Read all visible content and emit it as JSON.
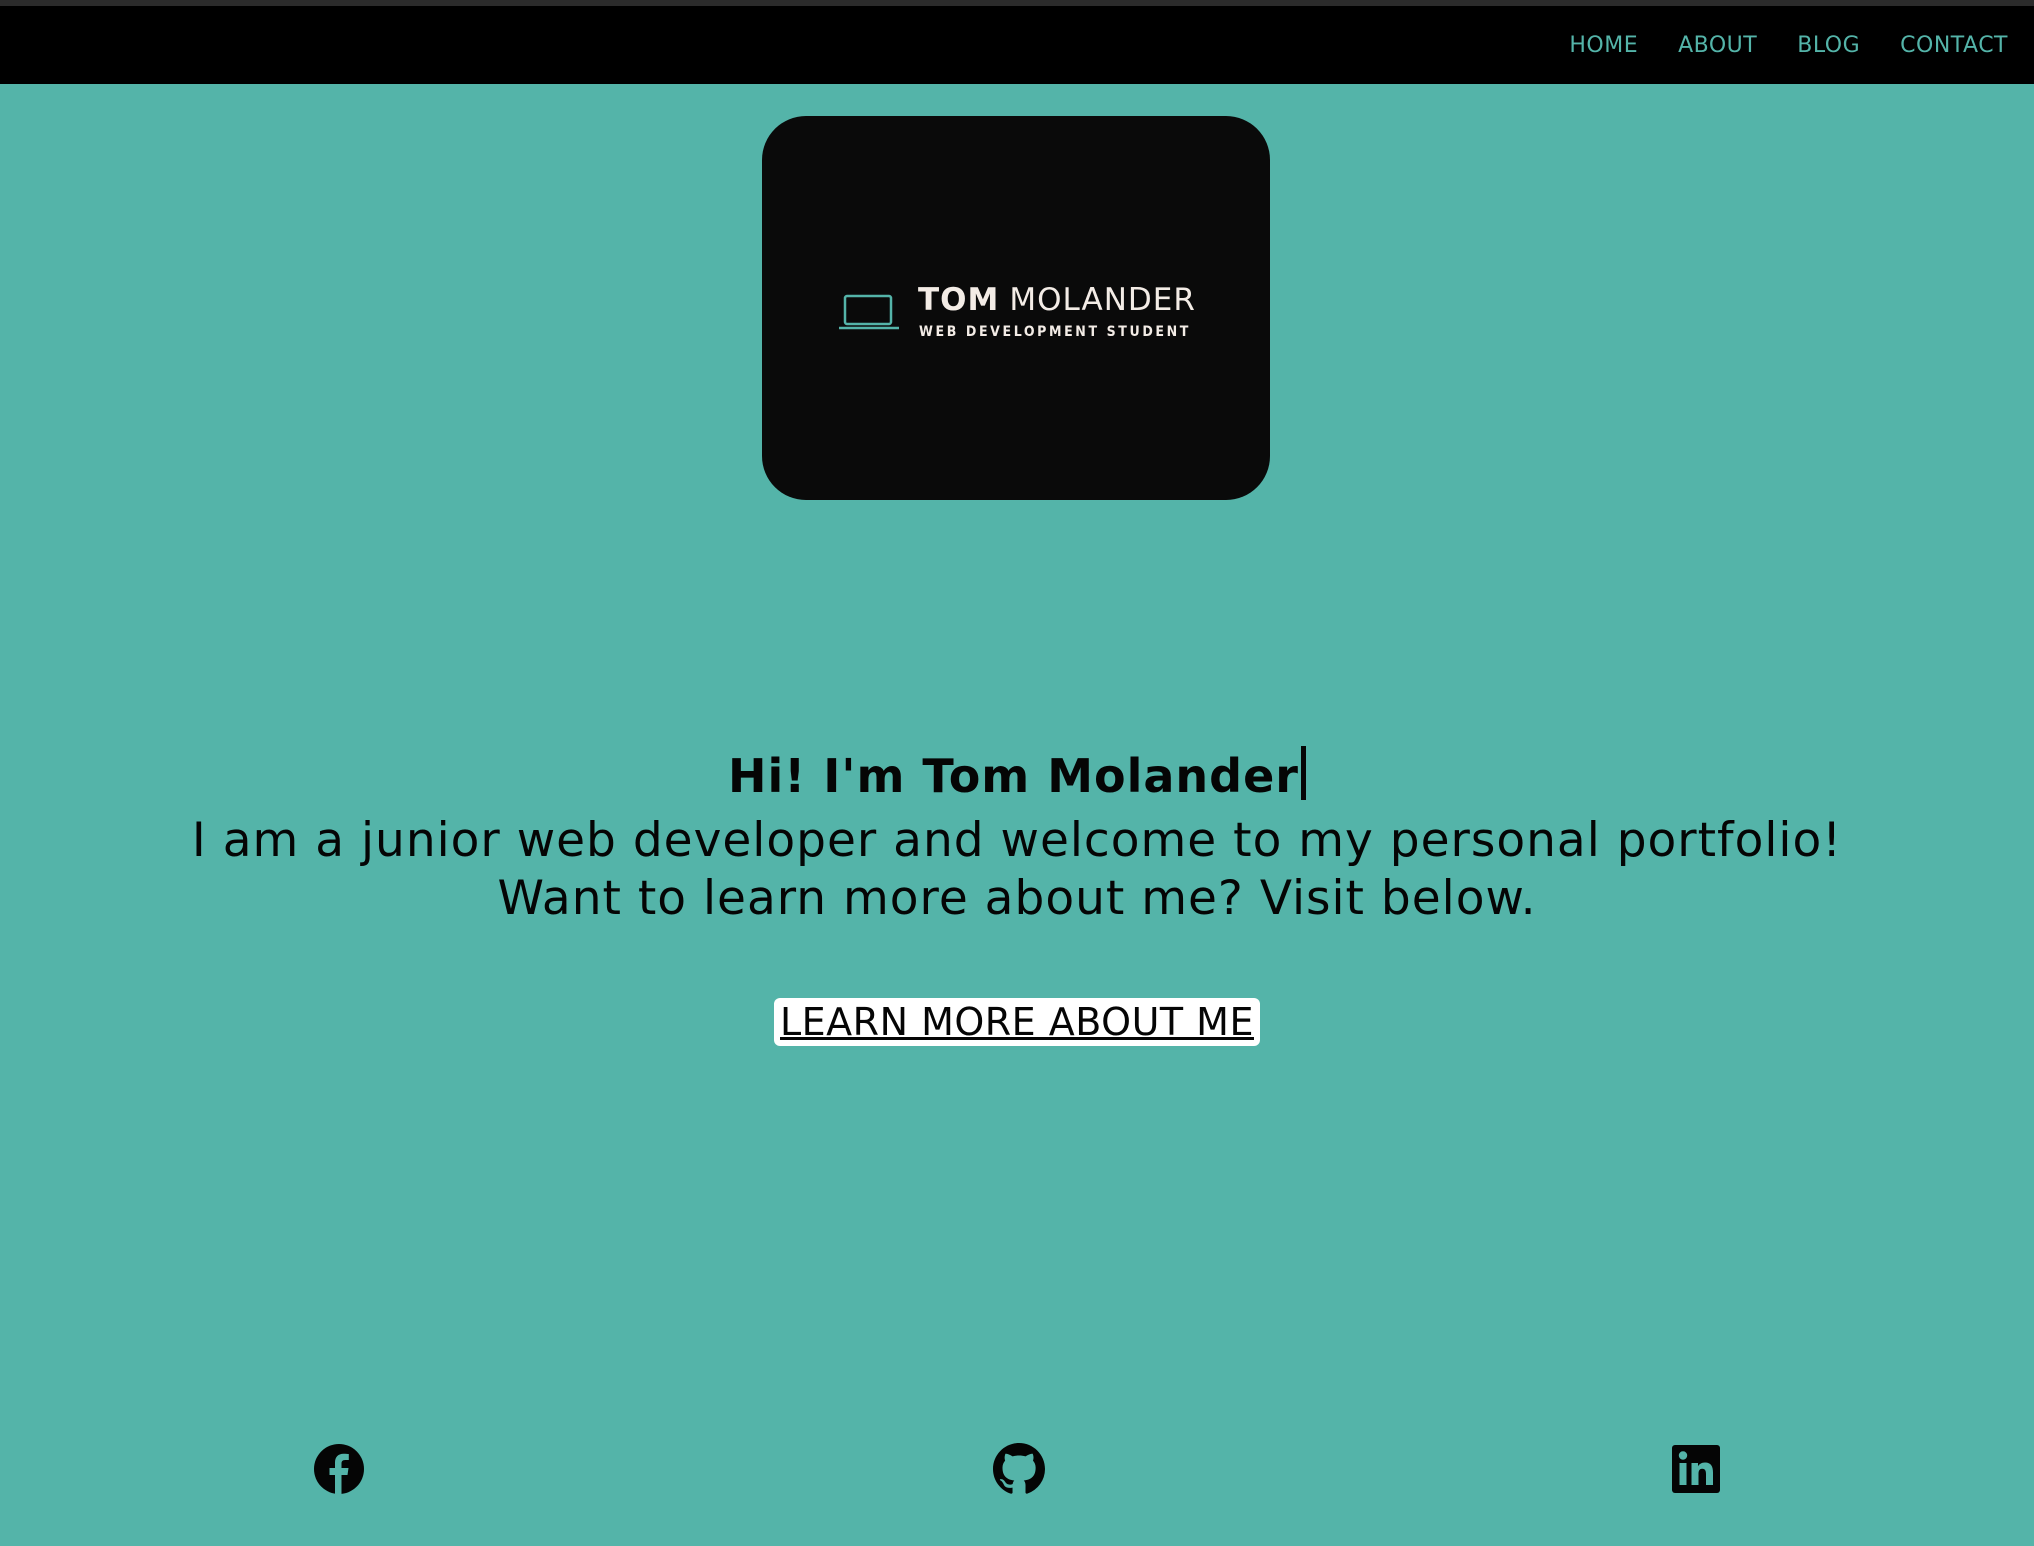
{
  "nav": {
    "links": [
      "HOME",
      "ABOUT",
      "BLOG",
      "CONTACT"
    ]
  },
  "logo": {
    "first_name": "TOM",
    "last_name": "MOLANDER",
    "subtitle": "WEB DEVELOPMENT STUDENT"
  },
  "hero": {
    "title": "Hi! I'm Tom Molander",
    "line1": "I am a junior web developer and welcome to my personal portfolio!",
    "line2": "Want to learn more about me? Visit below."
  },
  "cta": {
    "label": "LEARN MORE ABOUT ME"
  },
  "social": {
    "icons": [
      "facebook-icon",
      "github-icon",
      "linkedin-icon"
    ]
  },
  "colors": {
    "background": "#54b4a9",
    "navbar": "#000000",
    "nav_link": "#54b4a9",
    "logo_card": "#0a0a0a",
    "text": "#050505",
    "button_bg": "#ffffff"
  }
}
